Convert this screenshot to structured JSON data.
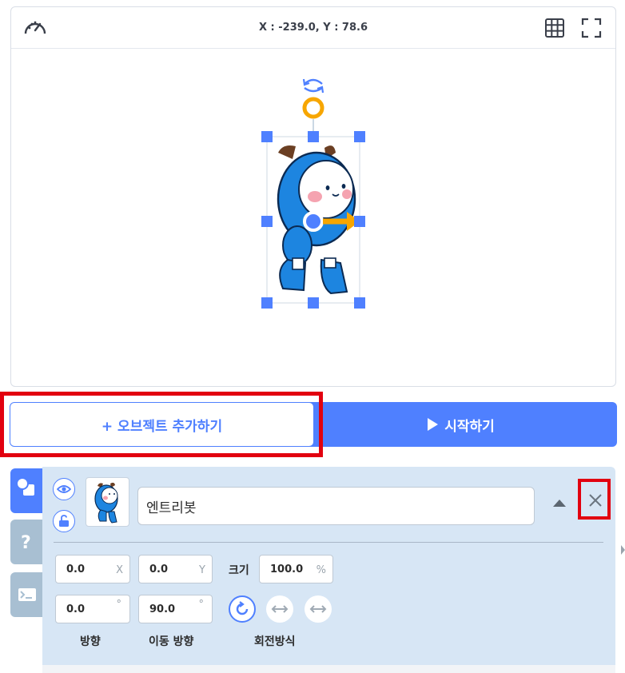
{
  "stage": {
    "coords": "X : -239.0, Y : 78.6",
    "icons": [
      "speed-gauge-icon",
      "grid-icon",
      "fullscreen-icon",
      "rotate-handle-icon"
    ]
  },
  "buttons": {
    "add_object": "+ 오브젝트 추가하기",
    "start": "시작하기"
  },
  "object": {
    "name": "엔트리봇",
    "x": "0.0",
    "x_unit": "X",
    "y": "0.0",
    "y_unit": "Y",
    "size_label": "크기",
    "size": "100.0",
    "size_unit": "%",
    "direction": "0.0",
    "move_direction": "90.0",
    "degree": "°",
    "direction_label": "방향",
    "move_direction_label": "이동 방향",
    "rotation_label": "회전방식"
  },
  "colors": {
    "accent": "#4f80ff",
    "highlight": "#e2000f",
    "panel_bg": "#d7e6f5",
    "handle_orange": "#f7a600"
  }
}
